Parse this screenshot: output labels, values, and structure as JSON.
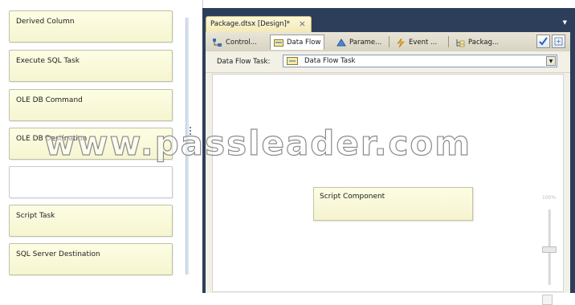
{
  "toolbox": {
    "items": [
      {
        "label": "Derived Column"
      },
      {
        "label": "Execute SQL Task"
      },
      {
        "label": "OLE DB Command"
      },
      {
        "label": "OLE DB Destination"
      },
      {
        "label": ""
      },
      {
        "label": "Script Task"
      },
      {
        "label": "SQL Server Destination"
      }
    ]
  },
  "document": {
    "tab_title": "Package.dtsx [Design]*",
    "close_glyph": "×"
  },
  "designer": {
    "tabs": [
      {
        "label": "Control...",
        "icon": "control-flow-icon"
      },
      {
        "label": "Data Flow",
        "icon": "data-flow-icon"
      },
      {
        "label": "Parame...",
        "icon": "parameters-icon"
      },
      {
        "label": "Event ...",
        "icon": "event-handlers-icon"
      },
      {
        "label": "Packag...",
        "icon": "package-explorer-icon"
      }
    ],
    "task_label": "Data Flow Task:",
    "task_value": "Data Flow Task",
    "canvas": {
      "component_label": "Script Component",
      "zoom_label": "100%"
    }
  },
  "watermark": "www.passleader.com",
  "colors": {
    "window_frame": "#2c3e5a",
    "card_fill": "#fdfde4",
    "doc_tab": "#f2e9b6"
  }
}
